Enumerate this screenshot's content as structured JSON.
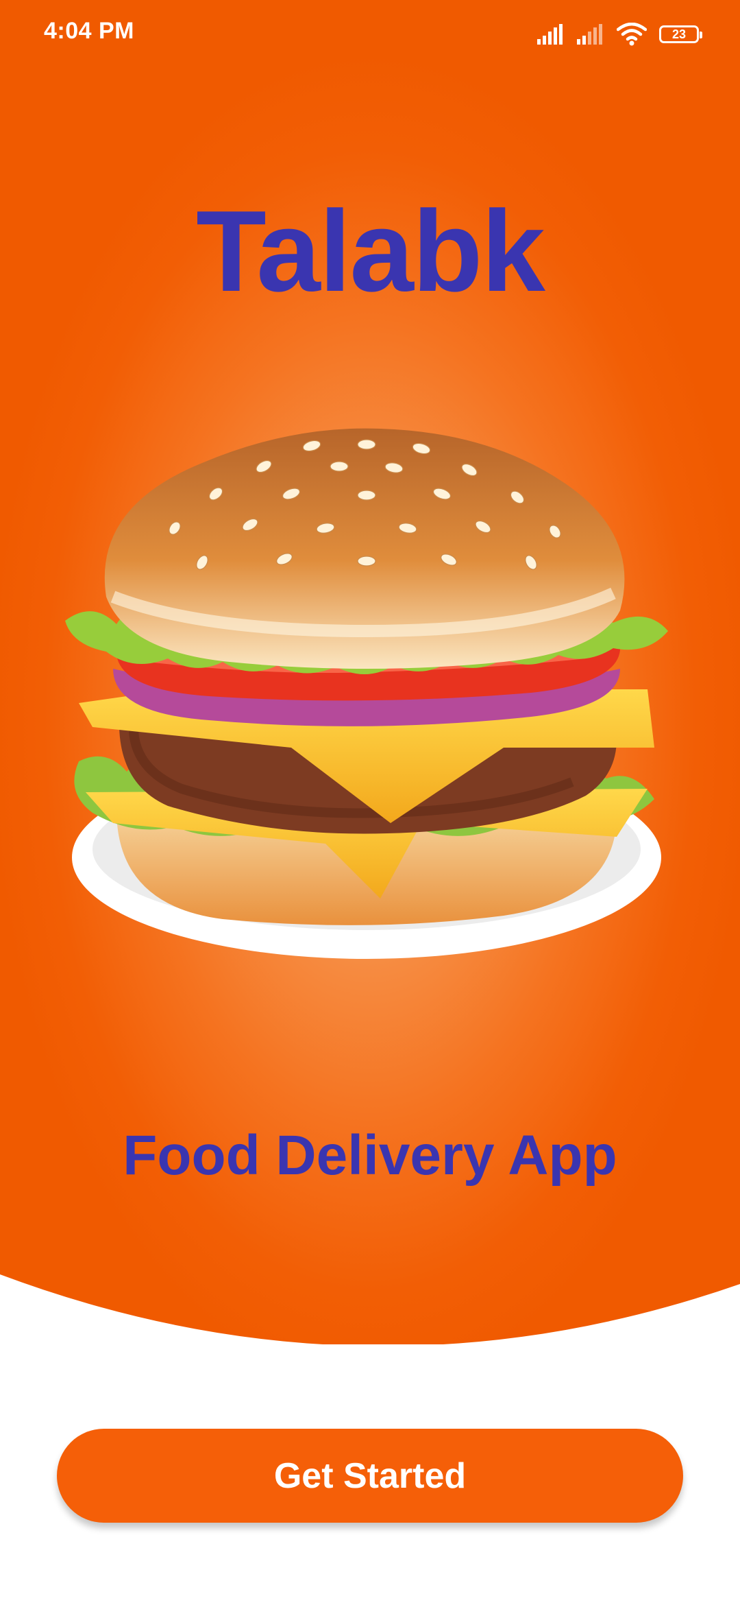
{
  "status_bar": {
    "time": "4:04 PM",
    "battery": "23",
    "icons": [
      "signal-icon",
      "signal-icon",
      "wifi-icon",
      "battery-icon"
    ]
  },
  "splash": {
    "app_name": "Talabk",
    "tagline": "Food Delivery App",
    "hero_image": "burger-illustration"
  },
  "actions": {
    "get_started_label": "Get Started"
  },
  "colors": {
    "accent": "#f55f08",
    "hero_center": "#f7b27c",
    "brand_text": "#3a35b0",
    "background": "#ffffff"
  }
}
